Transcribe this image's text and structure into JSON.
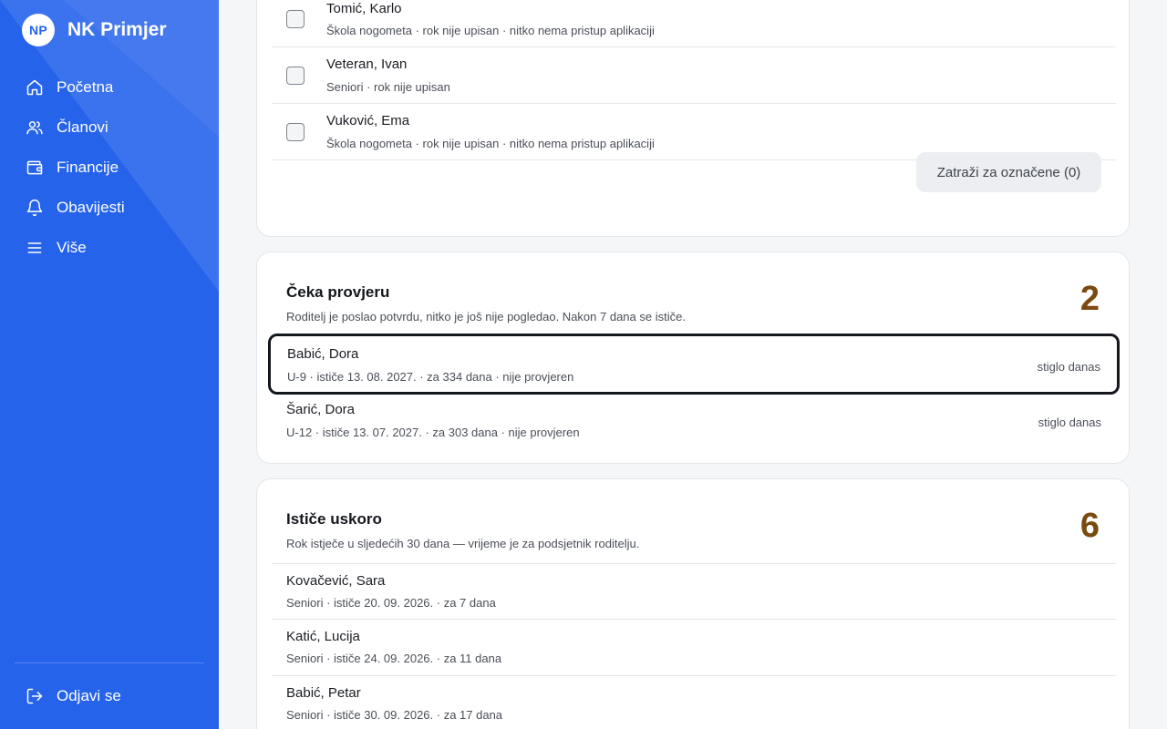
{
  "brand": {
    "initials": "NP",
    "name": "NK Primjer"
  },
  "nav": [
    {
      "label": "Početna",
      "icon": "home-icon"
    },
    {
      "label": "Članovi",
      "icon": "users-icon"
    },
    {
      "label": "Financije",
      "icon": "wallet-icon"
    },
    {
      "label": "Obavijesti",
      "icon": "bell-icon"
    },
    {
      "label": "Više",
      "icon": "menu-icon"
    }
  ],
  "logout": {
    "label": "Odjavi se",
    "icon": "logout-icon"
  },
  "colors": {
    "sidebar": "#2563eb",
    "count": "#7a4a10",
    "focus_border": "#14171c"
  },
  "pending": {
    "rows": [
      {
        "name": "Tomić, Karlo",
        "meta": "Škola nogometa · rok nije upisan · nitko nema pristup aplikaciji"
      },
      {
        "name": "Veteran, Ivan",
        "meta": "Seniori · rok nije upisan"
      },
      {
        "name": "Vuković, Ema",
        "meta": "Škola nogometa · rok nije upisan · nitko nema pristup aplikaciji"
      }
    ],
    "request_button": "Zatraži za označene (0)"
  },
  "review": {
    "title": "Čeka provjeru",
    "subtitle": "Roditelj je poslao potvrdu, nitko je još nije pogledao. Nakon 7 dana se ističe.",
    "count": "2",
    "rows": [
      {
        "name": "Babić, Dora",
        "meta": "U-9 · ističe 13. 08. 2027. · za 334 dana · nije provjeren",
        "arrived": "stiglo danas"
      },
      {
        "name": "Šarić, Dora",
        "meta": "U-12 · ističe 13. 07. 2027. · za 303 dana · nije provjeren",
        "arrived": "stiglo danas"
      }
    ]
  },
  "expiring": {
    "title": "Ističe uskoro",
    "subtitle": "Rok istječe u sljedećih 30 dana — vrijeme je za podsjetnik roditelju.",
    "count": "6",
    "rows": [
      {
        "name": "Kovačević, Sara",
        "meta": "Seniori · ističe 20. 09. 2026. · za 7 dana"
      },
      {
        "name": "Katić, Lucija",
        "meta": "Seniori · ističe 24. 09. 2026. · za 11 dana"
      },
      {
        "name": "Babić, Petar",
        "meta": "Seniori · ističe 30. 09. 2026. · za 17 dana"
      }
    ]
  }
}
